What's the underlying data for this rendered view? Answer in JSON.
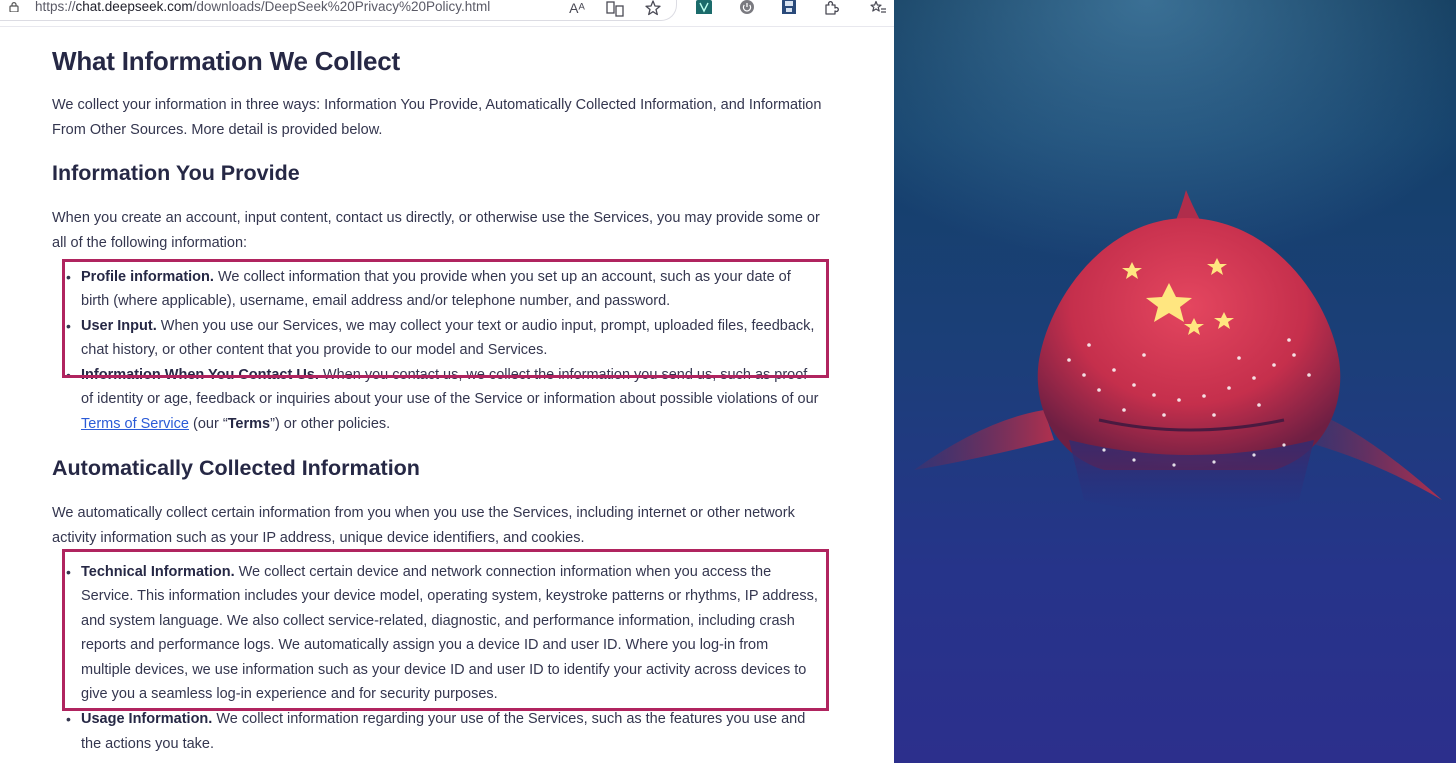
{
  "browser": {
    "url_scheme": "https://",
    "url_host": "chat.deepseek.com",
    "url_path": "/downloads/DeepSeek%20Privacy%20Policy.html",
    "read_aloud_glyph": "Aᴬ",
    "icons": [
      "lock-icon",
      "read-aloud-icon",
      "immersive-reader-icon",
      "favorite-star-icon",
      "extension-icon",
      "power-extension-icon",
      "save-extension-icon",
      "puzzle-extensions-icon",
      "favorites-list-icon"
    ]
  },
  "document": {
    "title": "What Information We Collect",
    "intro": "We collect your information in three ways: Information You Provide, Automatically Collected Information, and Information From Other Sources. More detail is provided below.",
    "section1": {
      "heading": "Information You Provide",
      "lead": "When you create an account, input content, contact us directly, or otherwise use the Services, you may provide some or all of the following information:",
      "items": [
        {
          "label": "Profile information.",
          "text": " We collect information that you provide when you set up an account, such as your date of birth (where applicable), username, email address and/or telephone number, and password."
        },
        {
          "label": "User Input.",
          "text": " When you use our Services, we may collect your text or audio input, prompt, uploaded files, feedback, chat history, or other content that you provide to our model and Services."
        },
        {
          "label": "Information When You Contact Us.",
          "text_before": " When you contact us, we collect the information you send us, such as proof of identity or age, feedback or inquiries about your use of the Service or information about possible violations of our ",
          "link": "Terms of Service",
          "text_mid": " (our “",
          "bold_term": "Terms",
          "text_after": "”) or other policies."
        }
      ]
    },
    "section2": {
      "heading": "Automatically Collected Information",
      "lead": "We automatically collect certain information from you when you use the Services, including internet or other network activity information such as your IP address, unique device identifiers, and cookies.",
      "items": [
        {
          "label": "Technical Information.",
          "text": " We collect certain device and network connection information when you access the Service. This information includes your device model, operating system, keystroke patterns or rhythms, IP address, and system language. We also collect service-related, diagnostic, and performance information, including crash reports and performance logs. We automatically assign you a device ID and user ID. Where you log-in from multiple devices, we use information such as your device ID and user ID to identify your activity across devices to give you a seamless log-in experience and for security purposes."
        },
        {
          "label": "Usage Information.",
          "text": " We collect information regarding your use of the Services, such as the features you use and the actions you take."
        }
      ]
    }
  },
  "colors": {
    "highlight_box": "#b0245f",
    "link": "#2b5bd7",
    "heading": "#262845",
    "whale_red": "#d8344f",
    "ocean_top": "#0e3556",
    "ocean_bottom": "#2c2f8c"
  }
}
